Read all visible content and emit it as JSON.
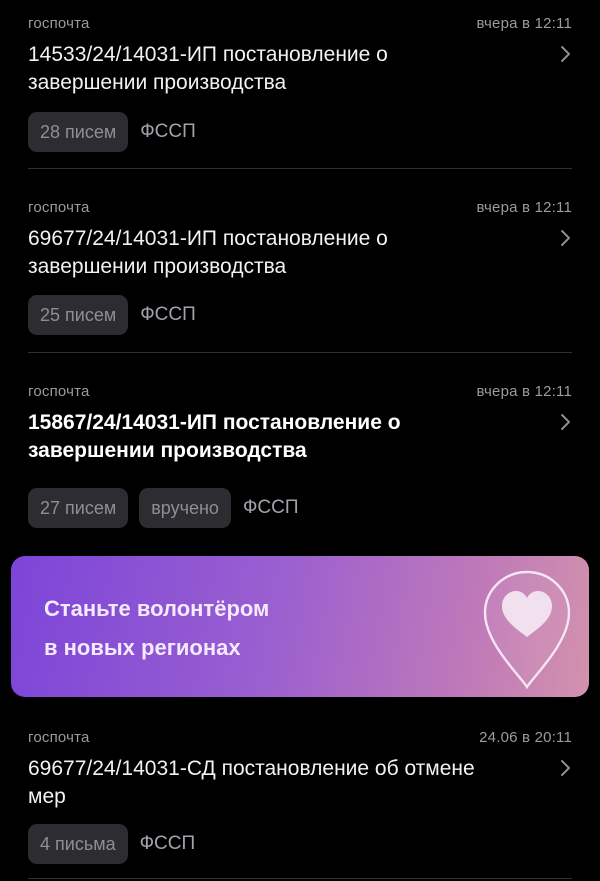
{
  "messages": [
    {
      "source": "госпочта",
      "time": "вчера в 12:11",
      "title_line1": "14533/24/14031-ИП постановление о",
      "title_line2": "завершении производства",
      "count": "28 писем",
      "status": "",
      "org": "ФССП",
      "unread": false
    },
    {
      "source": "госпочта",
      "time": "вчера в 12:11",
      "title_line1": "69677/24/14031-ИП постановление о",
      "title_line2": "завершении производства",
      "count": "25 писем",
      "status": "",
      "org": "ФССП",
      "unread": false
    },
    {
      "source": "госпочта",
      "time": "вчера в 12:11",
      "title_line1": "15867/24/14031-ИП постановление о",
      "title_line2": "завершении производства",
      "count": "27 писем",
      "status": "вручено",
      "org": "ФССП",
      "unread": true
    },
    {
      "source": "госпочта",
      "time": "24.06 в 20:11",
      "title_line1": "69677/24/14031-СД постановление об отмене",
      "title_line2": "мер",
      "count": "4 письма",
      "status": "",
      "org": "ФССП",
      "unread": false
    }
  ],
  "banner": {
    "line1": "Станьте волонтёром",
    "line2": "в новых регионах",
    "icon": "heart-pin-icon"
  },
  "icons": {
    "chevron": "chevron-right-icon"
  },
  "colors": {
    "background": "#000000",
    "banner_start": "#7c45d8",
    "banner_end": "#d392ad",
    "chip_bg": "#2c2c31",
    "meta_text": "#9a9aa0"
  }
}
